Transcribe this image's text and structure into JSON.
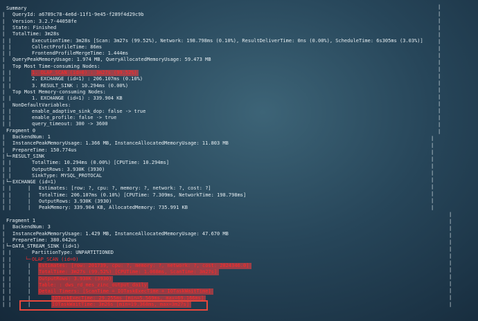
{
  "lines": [
    {
      "indent": 0,
      "text": "Summary"
    },
    {
      "indent": 1,
      "text": "QueryId: a6789c78-4e6d-11f1-9e45-f289f4d29c9b"
    },
    {
      "indent": 1,
      "text": "Version: 3.2.7-44058fe"
    },
    {
      "indent": 1,
      "text": "State: Finished"
    },
    {
      "indent": 1,
      "text": "TotalTime: 3m28s"
    },
    {
      "indent": 2,
      "text": "ExecutionTime: 3m28s [Scan: 3m27s (99.52%), Network: 198.798ms (0.10%), ResultDeliverTime: 0ns (0.00%), ScheduleTime: 6s305ms (3.03%)]"
    },
    {
      "indent": 2,
      "text": "CollectProfileTime: 86ms"
    },
    {
      "indent": 2,
      "text": "FrontendProfileMergeTime: 1.444ms"
    },
    {
      "indent": 1,
      "text": "QueryPeakMemoryUsage: 1.974 MB, QueryAllocatedMemoryUsage: 59.473 MB"
    },
    {
      "indent": 1,
      "text": "Top Most Time-consuming Nodes:"
    },
    {
      "indent": 2,
      "text": "1. OLAP_SCAN (id=0) : 3m27s (99.52%)",
      "red": true,
      "highlight": true
    },
    {
      "indent": 2,
      "text": "2. EXCHANGE (id=1) : 206.107ms (0.10%)"
    },
    {
      "indent": 2,
      "text": "3. RESULT_SINK : 10.294ms (0.00%)"
    },
    {
      "indent": 1,
      "text": "Top Most Memory-consuming Nodes:"
    },
    {
      "indent": 2,
      "text": "1. EXCHANGE (id=1) : 339.904 KB"
    },
    {
      "indent": 1,
      "text": "NonDefaultVariables:"
    },
    {
      "indent": 2,
      "text": "enable_adaptive_sink_dop: false -> true"
    },
    {
      "indent": 2,
      "text": "enable_profile: false -> true"
    },
    {
      "indent": 2,
      "text": "query_timeout: 300 -> 3600"
    },
    {
      "indent": 0,
      "text": "Fragment 0"
    },
    {
      "indent": 1,
      "text": "BackendNum: 1"
    },
    {
      "indent": 1,
      "text": "InstancePeakMemoryUsage: 1.366 MB, InstanceAllocatedMemoryUsage: 11.803 MB"
    },
    {
      "indent": 1,
      "text": "PrepareTime: 150.774us"
    },
    {
      "indent": 1,
      "text": "RESULT_SINK",
      "tree": true
    },
    {
      "indent": 2,
      "text": "TotalTime: 10.294ms (0.00%) [CPUTime: 10.294ms]"
    },
    {
      "indent": 2,
      "text": "OutputRows: 3.930K (3930)"
    },
    {
      "indent": 2,
      "text": "SinkType: MYSQL_PROTOCAL"
    },
    {
      "indent": 1,
      "text": "EXCHANGE (id=1)",
      "tree": true
    },
    {
      "indent": 3,
      "text": "Estimates: [row: ?, cpu: ?, memory: ?, network: ?, cost: ?]"
    },
    {
      "indent": 3,
      "text": "TotalTime: 206.107ms (0.10%) [CPUTime: 7.309ms, NetworkTime: 198.798ms]"
    },
    {
      "indent": 3,
      "text": "OutputRows: 3.930K (3930)"
    },
    {
      "indent": 3,
      "text": "PeakMemory: 339.904 KB, AllocatedMemory: 735.991 KB"
    },
    {
      "indent": 0,
      "text": ""
    },
    {
      "indent": 0,
      "text": "Fragment 1"
    },
    {
      "indent": 1,
      "text": "BackendNum: 3"
    },
    {
      "indent": 1,
      "text": "InstancePeakMemoryUsage: 1.429 MB, InstanceAllocatedMemoryUsage: 47.670 MB"
    },
    {
      "indent": 1,
      "text": "PrepareTime: 380.042us"
    },
    {
      "indent": 1,
      "text": "DATA_STREAM_SINK (id=1)",
      "tree": true
    },
    {
      "indent": 2,
      "text": "PartitionType: UNPARTITIONED"
    },
    {
      "indent": 2,
      "text": "OLAP_SCAN (id=0)",
      "red": true,
      "tree": true
    },
    {
      "indent": 3,
      "text": "Estimates: [row: 201739, cpu: ?, memory: ?, network: ?, cost: 2824346.0]",
      "red": true,
      "highlight": true
    },
    {
      "indent": 3,
      "text": "TotalTime: 3m27s (99.52%) [CPUTime: 1.068ms, ScanTime: 3m27s]",
      "red": true,
      "highlight": true
    },
    {
      "indent": 3,
      "text": "OutputRows: 3.930K (3930)",
      "red": true,
      "highlight": true
    },
    {
      "indent": 3,
      "text": "Table: : dws_rd_mes_zinc_output_daily",
      "red": true,
      "highlight": true
    },
    {
      "indent": 3,
      "text": "Detail Timers: [ScanTime = IOTaskExecTime + IOTaskWaitTime]",
      "red": true,
      "highlight": true
    },
    {
      "indent": 4,
      "text": "IOTaskExecTime: 29.255ms [min=5.569ms, max=69.166ms]",
      "red": true,
      "highlight": true
    },
    {
      "indent": 4,
      "text": "IOTaskWaitTime: 3m26s [min=19.368ms, max=3m27s]",
      "red": true,
      "highlight": true,
      "boxed": true
    }
  ]
}
